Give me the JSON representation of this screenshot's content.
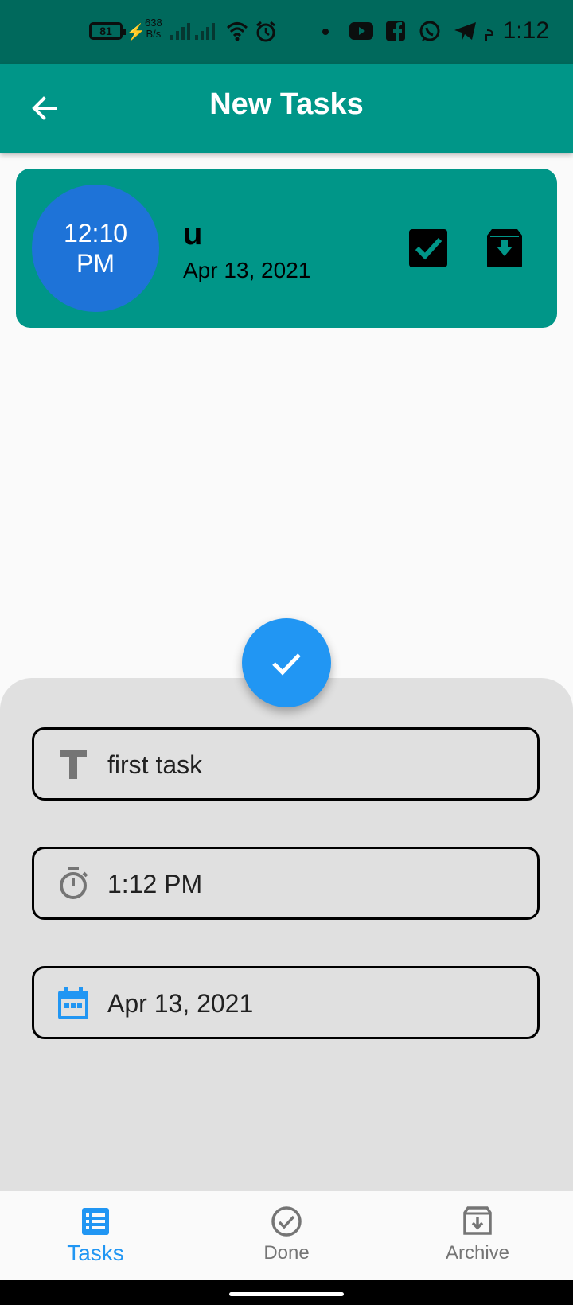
{
  "status_bar": {
    "battery_level": "81",
    "net_speed_value": "638",
    "net_speed_unit": "B/s",
    "time": "1:12"
  },
  "app_bar": {
    "title": "New Tasks",
    "back_icon": "arrow-back-icon"
  },
  "task": {
    "time_line1": "12:10",
    "time_line2": "PM",
    "title": "u",
    "date": "Apr 13, 2021",
    "done_icon": "check-box-icon",
    "archive_icon": "archive-icon"
  },
  "form": {
    "title_value": "first task",
    "title_icon": "title-icon",
    "time_value": "1:12 PM",
    "time_icon": "timer-icon",
    "date_value": "Apr 13, 2021",
    "date_icon": "calendar-icon"
  },
  "fab": {
    "icon": "check-icon"
  },
  "bottom_nav": {
    "items": [
      {
        "label": "Tasks",
        "icon": "list-icon",
        "active": true
      },
      {
        "label": "Done",
        "icon": "check-circle-icon",
        "active": false
      },
      {
        "label": "Archive",
        "icon": "archive-icon",
        "active": false
      }
    ]
  },
  "colors": {
    "status_bar": "#00695c",
    "app_bar": "#009688",
    "task_card": "#009688",
    "time_circle": "#1e73d8",
    "fab": "#2196f3",
    "active_nav": "#2196f3",
    "sheet": "#e0e0e0"
  }
}
